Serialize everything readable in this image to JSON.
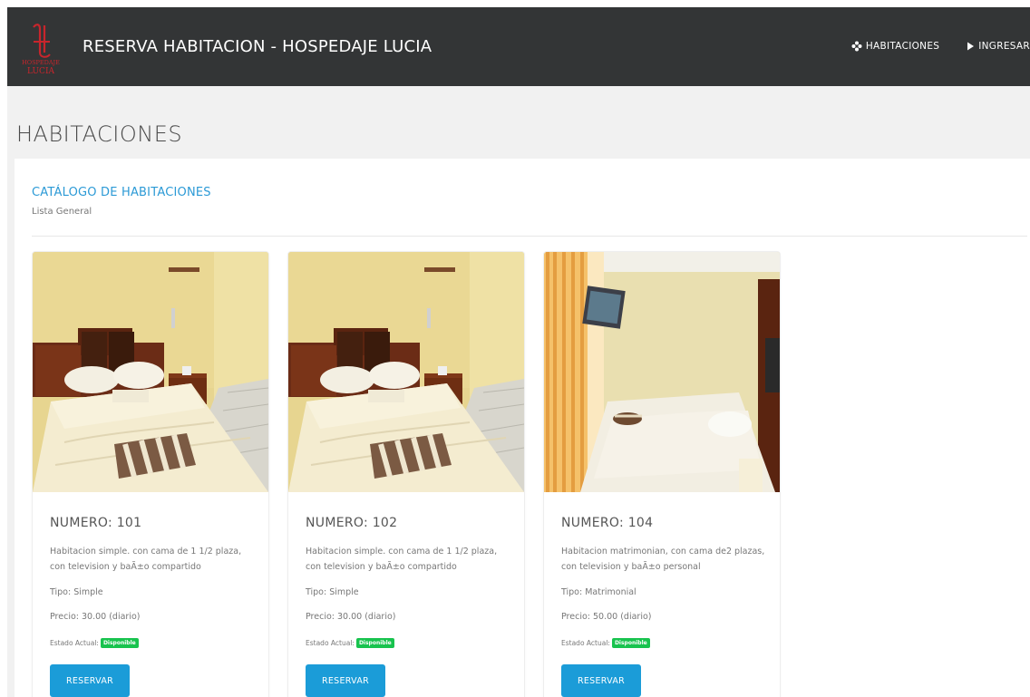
{
  "header": {
    "logo_text_top": "HOSPEDAJE",
    "logo_text_bottom": "LUCIA",
    "title": "RESERVA HABITACION - HOSPEDAJE LUCIA",
    "nav": [
      {
        "label": "HABITACIONES",
        "icon": "flower-icon"
      },
      {
        "label": "INGRESAR",
        "icon": "play-icon"
      }
    ],
    "colors": {
      "bar": "#333536",
      "logo": "#c8252c"
    }
  },
  "page": {
    "title": "HABITACIONES"
  },
  "catalog": {
    "title": "CATÁLOGO DE HABITACIONES",
    "subtitle": "Lista General",
    "title_color": "#2c9ad6"
  },
  "rooms": [
    {
      "title": "NUMERO: 101",
      "description": "Habitacion simple. con cama de 1 1/2 plaza, con television y baÃ±o compartido",
      "tipo": "Tipo: Simple",
      "precio": "Precio: 30.00 (diario)",
      "estado_label": "Estado Actual:",
      "estado_badge": "Disponible",
      "button": "RESERVAR",
      "image": "room-simple-photo"
    },
    {
      "title": "NUMERO: 102",
      "description": "Habitacion simple. con cama de 1 1/2 plaza, con television y baÃ±o compartido",
      "tipo": "Tipo: Simple",
      "precio": "Precio: 30.00 (diario)",
      "estado_label": "Estado Actual:",
      "estado_badge": "Disponible",
      "button": "RESERVAR",
      "image": "room-simple-photo"
    },
    {
      "title": "NUMERO: 104",
      "description": "Habitacion matrimonian, con cama de2 plazas, con television y baÃ±o personal",
      "tipo": "Tipo: Matrimonial",
      "precio": "Precio: 50.00 (diario)",
      "estado_label": "Estado Actual:",
      "estado_badge": "Disponible",
      "button": "RESERVAR",
      "image": "room-matrimonial-photo"
    }
  ],
  "colors": {
    "button": "#1b9cd8",
    "badge": "#18c34e"
  }
}
